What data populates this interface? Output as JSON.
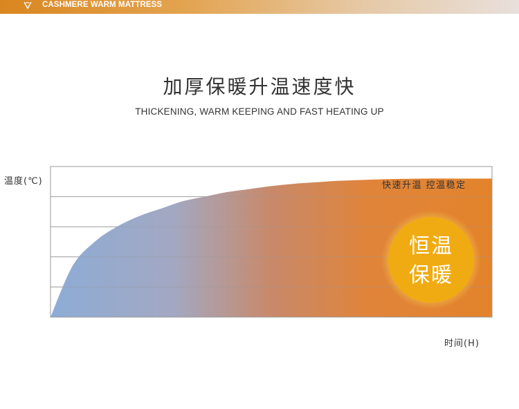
{
  "banner": {
    "brand_text": "CASHMERE WARM MATTRESS",
    "icon": "chevron-down-icon"
  },
  "heading": {
    "title": "加厚保暖升温速度快",
    "subtitle": "THICKENING, WARM KEEPING AND FAST HEATING UP"
  },
  "colors": {
    "banner_start": "#d9861f",
    "banner_end": "#e8e0dc",
    "curve_cool": "#8dacd6",
    "curve_warm": "#e3832b",
    "badge_fill": "#f1ab12",
    "grid": "#999999"
  },
  "chart_data": {
    "type": "area",
    "xlabel": "时间(H)",
    "ylabel": "温度(℃)",
    "annotation": "快速升温 控温稳定",
    "badge_lines": [
      "恒温",
      "保暖"
    ],
    "grid": true,
    "gridline_count": 5,
    "x": [
      0,
      0.05,
      0.1,
      0.15,
      0.2,
      0.25,
      0.3,
      0.35,
      0.4,
      0.45,
      0.5,
      0.55,
      0.6,
      0.65,
      0.7,
      0.75,
      0.8,
      0.85,
      0.9,
      0.95,
      1.0
    ],
    "y": [
      0,
      0.34,
      0.5,
      0.6,
      0.67,
      0.72,
      0.77,
      0.8,
      0.83,
      0.85,
      0.87,
      0.885,
      0.895,
      0.905,
      0.91,
      0.915,
      0.918,
      0.92,
      0.92,
      0.92,
      0.92
    ],
    "xlim": [
      0,
      1
    ],
    "ylim": [
      0,
      1
    ]
  }
}
